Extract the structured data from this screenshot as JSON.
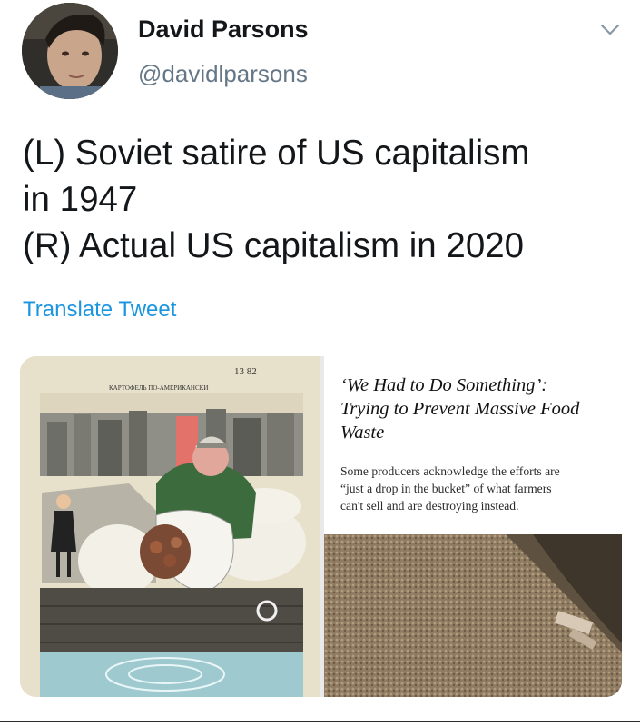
{
  "author": {
    "display_name": "David Parsons",
    "handle": "@davidlparsons",
    "avatar_icon": "user-avatar-photo"
  },
  "menu": {
    "icon": "chevron-down-icon"
  },
  "tweet": {
    "lines": [
      "(L) Soviet satire of US capitalism",
      "in 1947",
      "(R) Actual US capitalism in 2020"
    ],
    "translate_label": "Translate Tweet"
  },
  "media": {
    "left_image": {
      "description_icon": "soviet-cartoon-image",
      "issue_number": "13 82",
      "caption": "КАРТОФЕЛЬ ПО-АМЕРИКАНСКИ"
    },
    "right_article": {
      "headline": "‘We Had to Do Something’:\nTrying to Prevent Massive Food\nWaste",
      "summary": "Some producers acknowledge the efforts are\n“just a drop in the bucket” of what farmers\ncan't sell and are destroying instead.",
      "photo_icon": "potato-pile-photo"
    }
  },
  "colors": {
    "link": "#1b95e0",
    "handle": "#657786",
    "text": "#14171a"
  }
}
